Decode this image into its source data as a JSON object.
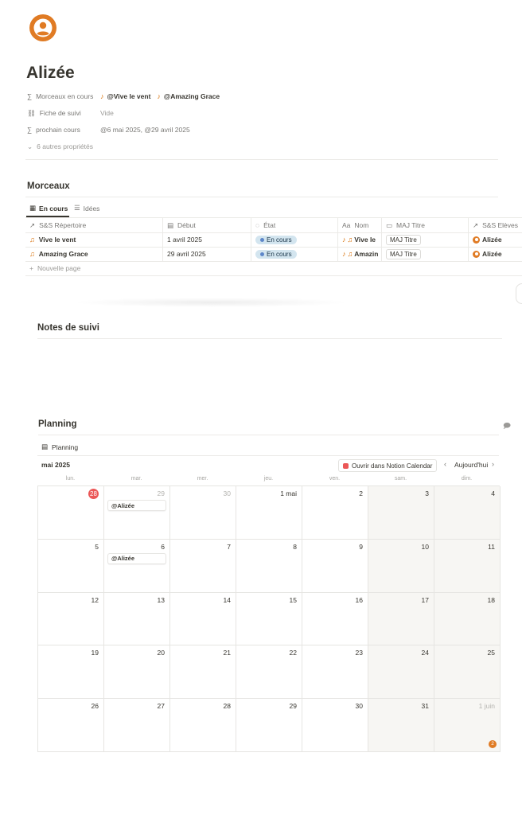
{
  "page": {
    "title": "Alizée",
    "properties": [
      {
        "key": "Morceaux en cours",
        "icon": "sigma-icon",
        "values": [
          "@Vive le vent",
          "@Amazing Grace"
        ]
      },
      {
        "key": "Fiche de suivi",
        "icon": "link-icon",
        "value": "Vide"
      },
      {
        "key": "prochain cours",
        "icon": "sigma-icon",
        "value": "@6 mai 2025, @29 avril 2025"
      }
    ],
    "more_properties": "6 autres propriétés"
  },
  "morceaux": {
    "title": "Morceaux",
    "tabs": [
      {
        "label": "En cours",
        "active": true
      },
      {
        "label": "Idées",
        "active": false
      }
    ],
    "columns": [
      "S&S Répertoire",
      "Début",
      "État",
      "Nom",
      "MAJ Titre",
      "S&S Elèves"
    ],
    "rows": [
      {
        "repertoire": "Vive le vent",
        "debut": "1 avril 2025",
        "etat": "En cours",
        "nom": "Vive le",
        "maj": "MAJ Titre",
        "eleve": "Alizée"
      },
      {
        "repertoire": "Amazing Grace",
        "debut": "29 avril 2025",
        "etat": "En cours",
        "nom": "Amazin",
        "maj": "MAJ Titre",
        "eleve": "Alizée"
      }
    ],
    "new_page": "Nouvelle page"
  },
  "notes": {
    "title": "Notes de suivi"
  },
  "planning": {
    "title": "Planning",
    "view_label": "Planning",
    "month": "mai 2025",
    "open_button": "Ouvrir dans Notion Calendar",
    "today_button": "Aujourd'hui",
    "weekdays": [
      "lun.",
      "mar.",
      "mer.",
      "jeu.",
      "ven.",
      "sam.",
      "dim."
    ],
    "weeks": [
      [
        "28",
        "29",
        "30",
        "1 mai",
        "2",
        "3",
        "4"
      ],
      [
        "5",
        "6",
        "7",
        "8",
        "9",
        "10",
        "11"
      ],
      [
        "12",
        "13",
        "14",
        "15",
        "16",
        "17",
        "18"
      ],
      [
        "19",
        "20",
        "21",
        "22",
        "23",
        "24",
        "25"
      ],
      [
        "26",
        "27",
        "28",
        "29",
        "30",
        "31",
        "1 juin"
      ]
    ],
    "events": [
      {
        "week": 0,
        "day": 1,
        "label": "@Alizée"
      },
      {
        "week": 1,
        "day": 1,
        "label": "@Alizée"
      }
    ],
    "overflow_badge": "2"
  },
  "colors": {
    "accent_orange": "#e07b24",
    "today_red": "#eb5757",
    "state_blue": "#d3e5ef"
  }
}
